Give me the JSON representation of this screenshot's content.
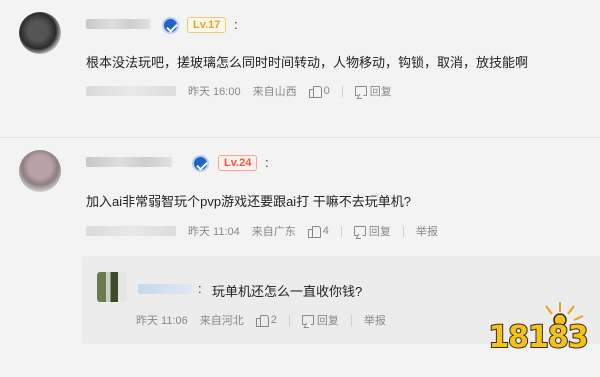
{
  "comments": [
    {
      "level": "Lv.17",
      "text": "根本没法玩吧，搓玻璃怎么同时时间转动，人物移动，钩锁，取消，放技能啊",
      "time": "昨天 16:00",
      "location": "来自山西",
      "likes": "0",
      "reply_label": "回复"
    },
    {
      "level": "Lv.24",
      "text": "加入ai非常弱智玩个pvp游戏还要跟ai打 干嘛不去玩单机?",
      "time": "昨天 11:04",
      "location": "来自广东",
      "likes": "4",
      "reply_label": "回复",
      "report_label": "举报"
    }
  ],
  "reply": {
    "text": "玩单机还怎么一直收你钱?",
    "time": "昨天 11:06",
    "location": "来自河北",
    "likes": "2",
    "reply_label": "回复",
    "report_label": "举报"
  },
  "watermark": {
    "text": "18183"
  },
  "colors": {
    "level_17": "#e7a028",
    "level_24": "#e55a3c",
    "vip_badge": "#1e64c8",
    "watermark": "#f4c21a"
  }
}
